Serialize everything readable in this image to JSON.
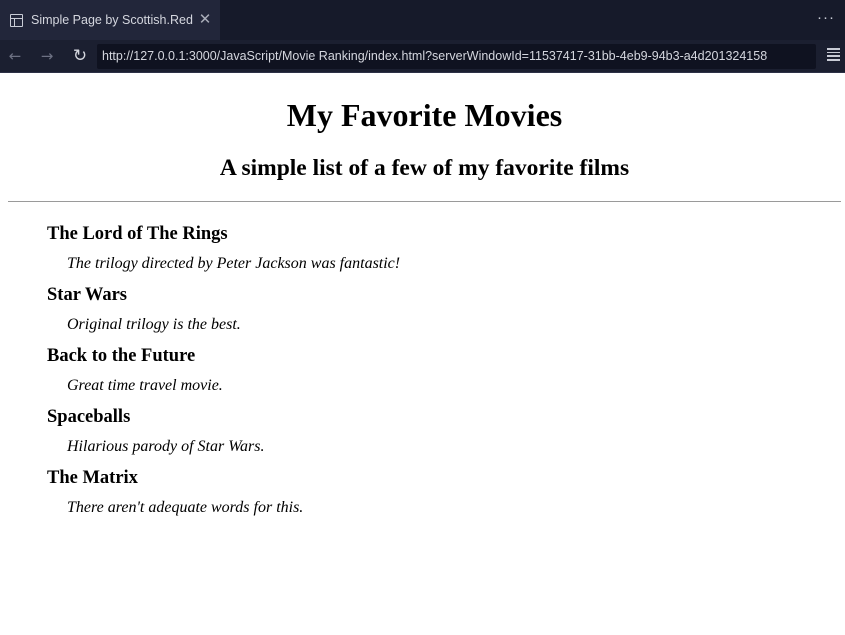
{
  "browser": {
    "tab_title": "Simple Page by Scottish.Red",
    "tab_close_glyph": "✕",
    "more_glyph": "···",
    "url": "http://127.0.0.1:3000/JavaScript/Movie Ranking/index.html?serverWindowId=11537417-31bb-4eb9-94b3-a4d201324158",
    "back_glyph": "←",
    "forward_glyph": "→",
    "reload_glyph": "↻",
    "colors": {
      "tabbar": "#161a2a",
      "active_tab": "#22263a",
      "navbar": "#1b1f30"
    }
  },
  "page": {
    "title": "My Favorite Movies",
    "subtitle": "A simple list of a few of my favorite films",
    "movies": [
      {
        "name": "The Lord of The Rings",
        "description": "The trilogy directed by Peter Jackson was fantastic!"
      },
      {
        "name": "Star Wars",
        "description": "Original trilogy is the best."
      },
      {
        "name": "Back to the Future",
        "description": "Great time travel movie."
      },
      {
        "name": "Spaceballs",
        "description": "Hilarious parody of Star Wars."
      },
      {
        "name": "The Matrix",
        "description": "There aren't adequate words for this."
      }
    ]
  }
}
